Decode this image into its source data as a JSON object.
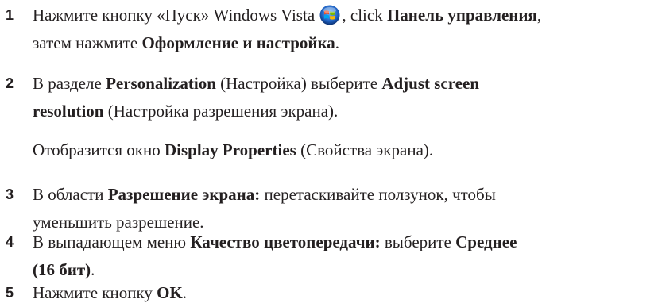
{
  "steps": [
    {
      "number": "1",
      "a": "Нажмите кнопку «Пуск» Windows Vista",
      "b": ", click ",
      "c": "Панель управления",
      "d": ",",
      "e": "затем нажмите ",
      "f": "Оформление и настройка",
      "g": "."
    },
    {
      "number": "2",
      "a": "В разделе ",
      "b": "Personalization",
      "c": " (Настройка) выберите ",
      "d": "Adjust screen",
      "e": "resolution",
      "f": " (Настройка разрешения экрана)."
    },
    {
      "a": "Отобразится окно ",
      "b": "Display Properties",
      "c": " (Свойства экрана)."
    },
    {
      "number": "3",
      "a": "В области ",
      "b": "Разрешение экрана:",
      "c": " перетаскивайте ползунок, чтобы",
      "d": "уменьшить разрешение."
    },
    {
      "number": "4",
      "a": "В выпадающем меню ",
      "b": "Качество цветопередачи:",
      "c": " выберите ",
      "d": "Среднее",
      "e": "(16 бит)",
      "f": "."
    },
    {
      "number": "5",
      "a": "Нажмите кнопку ",
      "b": "OK",
      "c": "."
    }
  ],
  "icons": {
    "start_button": "windows-vista-start-orb-icon"
  }
}
